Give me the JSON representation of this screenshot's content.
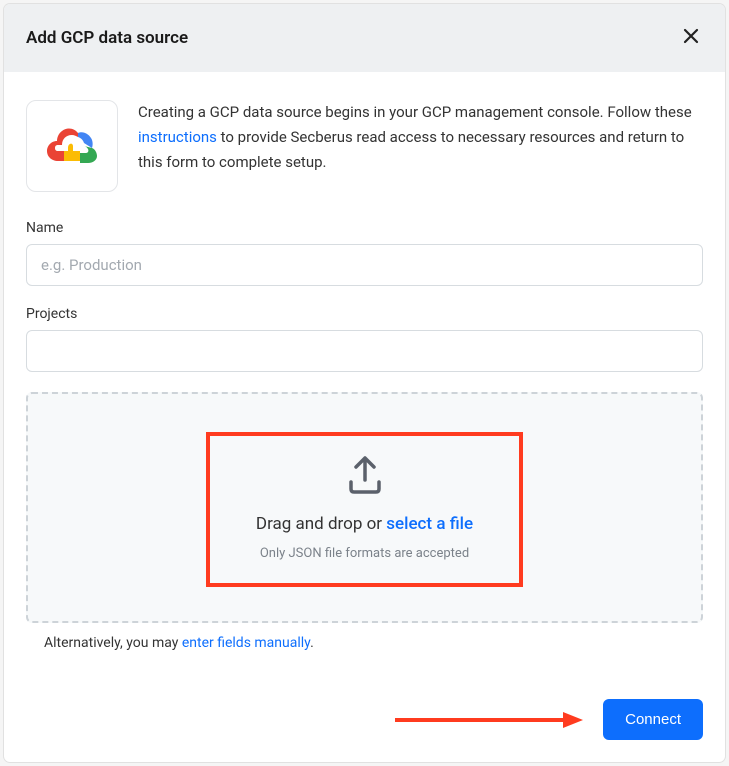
{
  "header": {
    "title": "Add GCP data source"
  },
  "intro": {
    "text_before": "Creating a GCP data source begins in your GCP management console. Follow these ",
    "link_text": "instructions",
    "text_after": " to provide Secberus read access to necessary resources and return to this form to complete setup."
  },
  "fields": {
    "name_label": "Name",
    "name_placeholder": "e.g. Production",
    "name_value": "",
    "projects_label": "Projects",
    "projects_value": ""
  },
  "dropzone": {
    "prefix": "Drag and drop or ",
    "link": "select a file",
    "hint": "Only JSON file formats are accepted"
  },
  "alternative": {
    "prefix": "Alternatively, you may ",
    "link": "enter fields manually",
    "suffix": "."
  },
  "buttons": {
    "connect": "Connect"
  }
}
